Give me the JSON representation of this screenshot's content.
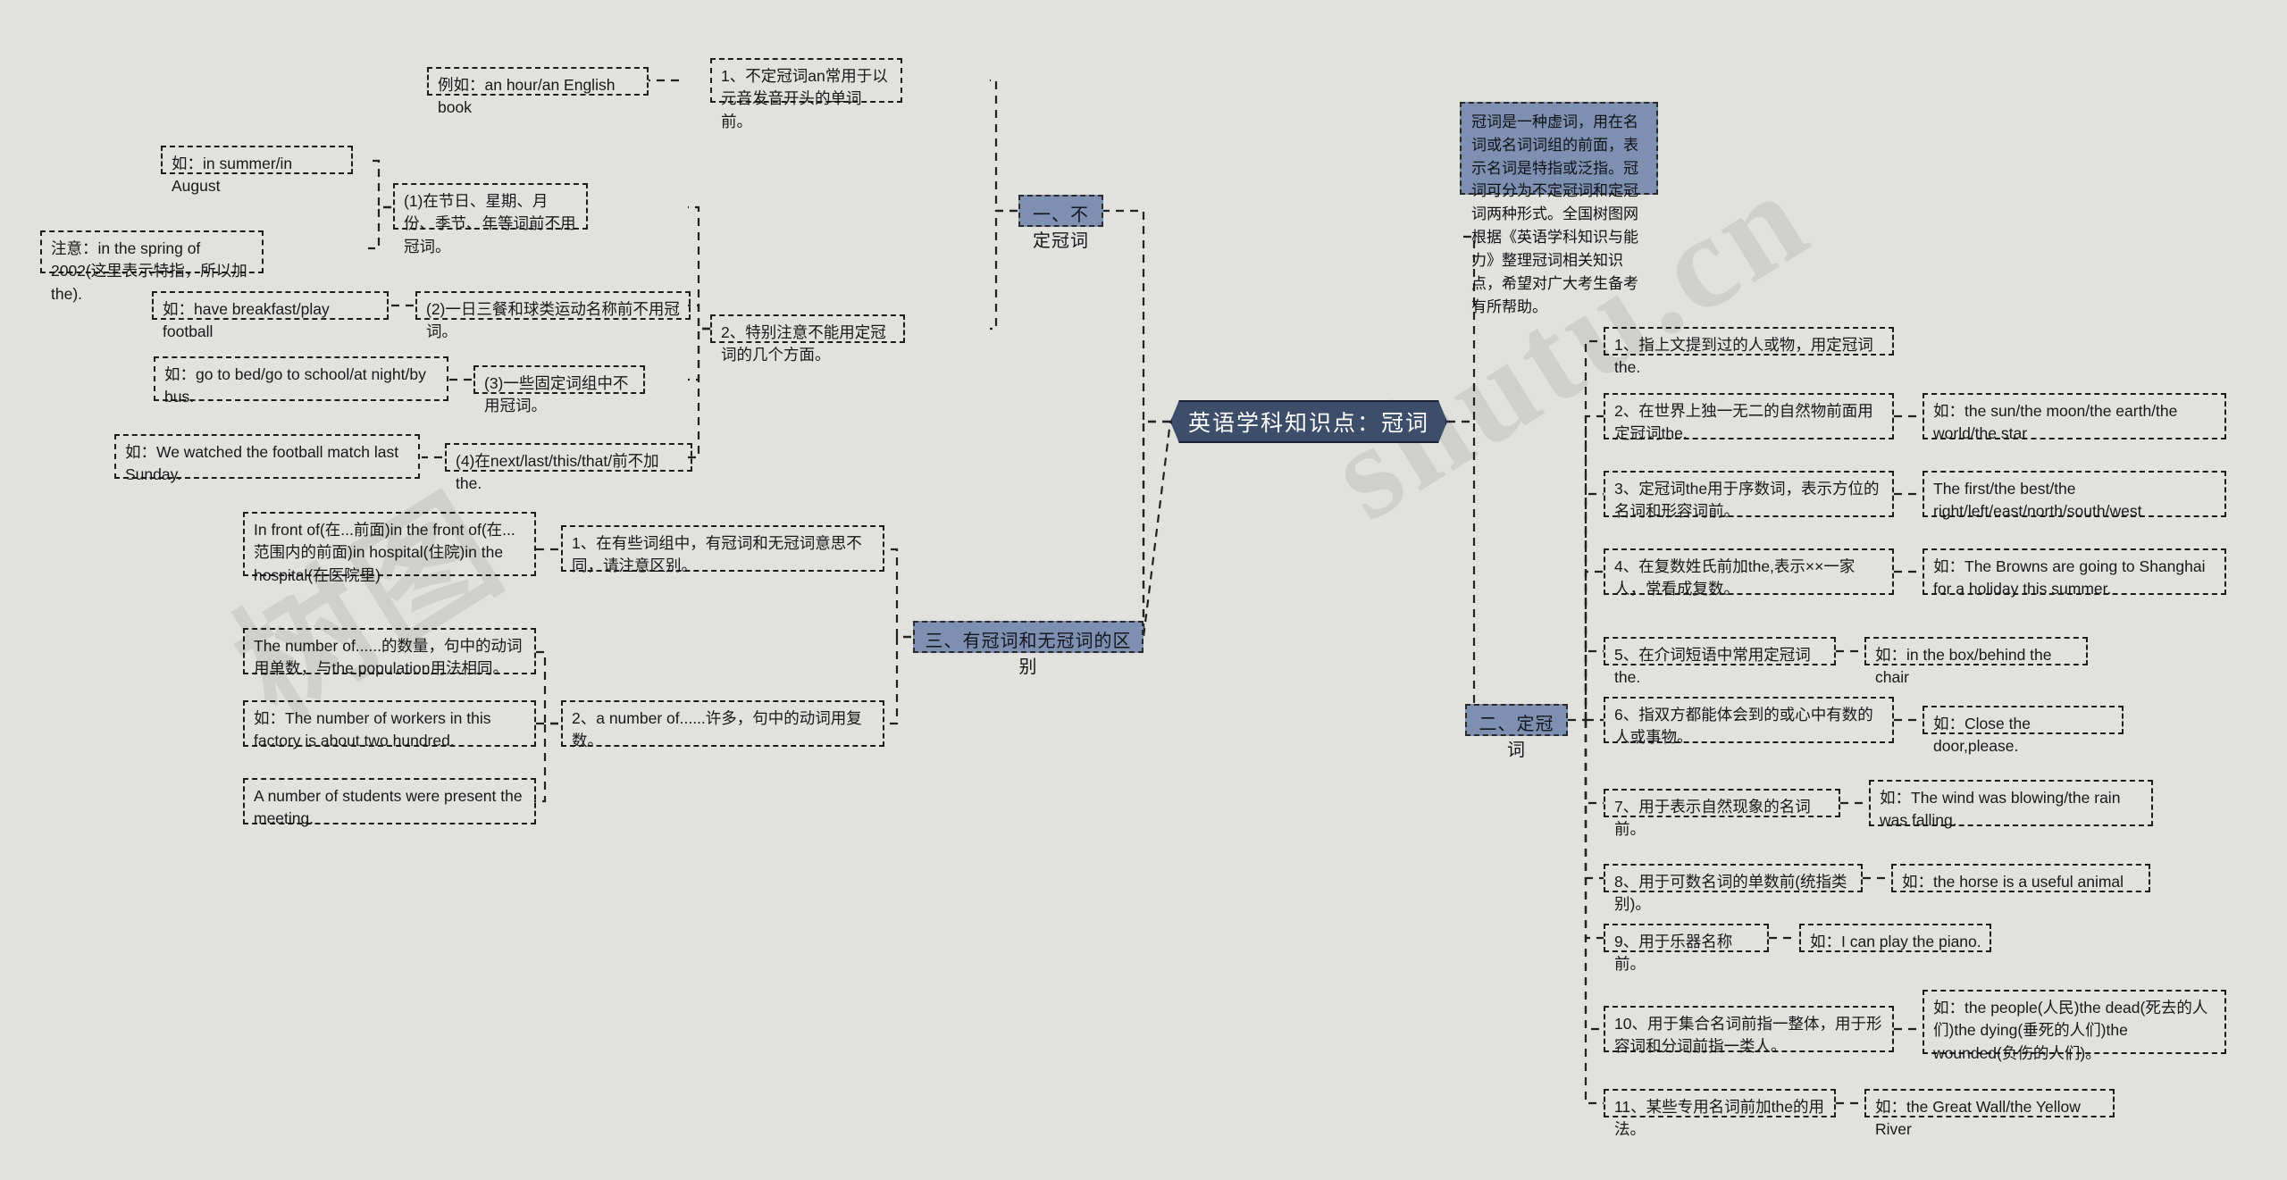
{
  "meta": {
    "background_color": "#e1e2de",
    "accent_color": "#7e90b1",
    "root_color": "#3d4e6b",
    "watermark_left": "树图",
    "watermark_right": "shutu.cn"
  },
  "root": {
    "label": "英语学科知识点：冠词"
  },
  "info_box": {
    "text": "冠词是一种虚词，用在名词或名词词组的前面，表示名词是特指或泛指。冠词可分为不定冠词和定冠词两种形式。全国树图网根据《英语学科知识与能力》整理冠词相关知识点，希望对广大考生备考有所帮助。"
  },
  "branches": [
    {
      "id": "indefinite",
      "label": "一、不定冠词",
      "children": [
        {
          "label": "1、不定冠词an常用于以元音发音开头的单词前。",
          "children": [
            {
              "label": "例如：an hour/an English book"
            }
          ]
        },
        {
          "label": "2、特别注意不能用定冠词的几个方面。",
          "children": [
            {
              "label": "(1)在节日、星期、月份、季节、年等词前不用冠词。",
              "children": [
                {
                  "label": "如：in summer/in August"
                },
                {
                  "label": "注意：in the spring of 2002(这里表示特指，所以加the)."
                }
              ]
            },
            {
              "label": "(2)一日三餐和球类运动名称前不用冠词。",
              "children": [
                {
                  "label": "如：have breakfast/play football"
                }
              ]
            },
            {
              "label": "(3)一些固定词组中不用冠词。",
              "children": [
                {
                  "label": "如：go to bed/go to school/at night/by bus."
                }
              ]
            },
            {
              "label": "(4)在next/last/this/that/前不加the.",
              "children": [
                {
                  "label": "如：We watched the football match last Sunday."
                }
              ]
            }
          ]
        }
      ]
    },
    {
      "id": "definite",
      "label": "二、定冠词",
      "children": [
        {
          "label": "1、指上文提到过的人或物，用定冠词the.",
          "children": []
        },
        {
          "label": "2、在世界上独一无二的自然物前面用定冠词the.",
          "children": [
            {
              "label": "如：the sun/the moon/the earth/the world/the star"
            }
          ]
        },
        {
          "label": "3、定冠词the用于序数词，表示方位的名词和形容词前。",
          "children": [
            {
              "label": "The first/the best/the right/left/east/north/south/west"
            }
          ]
        },
        {
          "label": "4、在复数姓氏前加the,表示××一家人，常看成复数。",
          "children": [
            {
              "label": "如：The Browns are going to Shanghai for a holiday this summer."
            }
          ]
        },
        {
          "label": "5、在介词短语中常用定冠词the.",
          "children": [
            {
              "label": "如：in the box/behind the chair"
            }
          ]
        },
        {
          "label": "6、指双方都能体会到的或心中有数的人或事物。",
          "children": [
            {
              "label": "如：Close the door,please."
            }
          ]
        },
        {
          "label": "7、用于表示自然现象的名词前。",
          "children": [
            {
              "label": "如：The wind was blowing/the rain was falling."
            }
          ]
        },
        {
          "label": "8、用于可数名词的单数前(统指类别)。",
          "children": [
            {
              "label": "如：the horse is a useful animal"
            }
          ]
        },
        {
          "label": "9、用于乐器名称前。",
          "children": [
            {
              "label": "如：I can play the piano."
            }
          ]
        },
        {
          "label": "10、用于集合名词前指一整体，用于形容词和分词前指一类人。",
          "children": [
            {
              "label": "如：the people(人民)the dead(死去的人们)the dying(垂死的人们)the wounded(负伤的人们)。"
            }
          ]
        },
        {
          "label": "11、某些专用名词前加the的用法。",
          "children": [
            {
              "label": "如：the Great Wall/the Yellow River"
            }
          ]
        }
      ]
    },
    {
      "id": "difference",
      "label": "三、有冠词和无冠词的区别",
      "children": [
        {
          "label": "1、在有些词组中，有冠词和无冠词意思不同，请注意区别。",
          "children": [
            {
              "label": "In front of(在...前面)in the front of(在...范围内的前面)in hospital(住院)in the hospital(在医院里)"
            }
          ]
        },
        {
          "label": "2、a number of......许多，句中的动词用复数。",
          "children": [
            {
              "label": "The number of......的数量，句中的动词用单数，与the population用法相同。"
            },
            {
              "label": "如：The number of workers in this factory is about two hundred."
            },
            {
              "label": "A number of students were present the meeting."
            }
          ]
        }
      ]
    }
  ]
}
